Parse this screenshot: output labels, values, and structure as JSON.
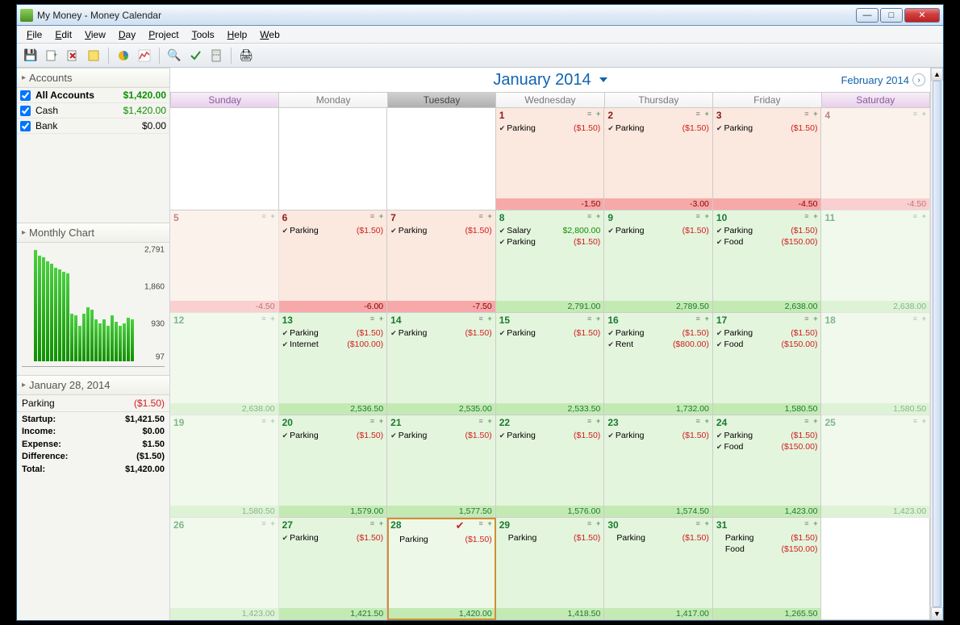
{
  "window": {
    "title": "My Money - Money Calendar"
  },
  "menus": [
    {
      "label": "File",
      "u": "F"
    },
    {
      "label": "Edit",
      "u": "E"
    },
    {
      "label": "View",
      "u": "V"
    },
    {
      "label": "Day",
      "u": "D"
    },
    {
      "label": "Project",
      "u": "P"
    },
    {
      "label": "Tools",
      "u": "T"
    },
    {
      "label": "Help",
      "u": "H"
    },
    {
      "label": "Web",
      "u": "W"
    }
  ],
  "accounts": {
    "header": "Accounts",
    "rows": [
      {
        "name": "All Accounts",
        "amount": "$1,420.00",
        "bold": true,
        "green": true
      },
      {
        "name": "Cash",
        "amount": "$1,420.00",
        "green": true
      },
      {
        "name": "Bank",
        "amount": "$0.00"
      }
    ]
  },
  "monthly_chart": {
    "header": "Monthly Chart"
  },
  "chart_data": {
    "type": "bar",
    "yticks": [
      97,
      930,
      1860,
      2791
    ],
    "values": [
      2791,
      2650,
      2600,
      2500,
      2450,
      2350,
      2300,
      2250,
      2200,
      1200,
      1150,
      900,
      1200,
      1350,
      1300,
      1050,
      950,
      1050,
      900,
      1150,
      1000,
      900,
      950,
      1100,
      1050
    ],
    "ylabel": "",
    "xlabel": ""
  },
  "day_panel": {
    "header": "January 28, 2014",
    "transactions": [
      {
        "name": "Parking",
        "amount": "($1.50)",
        "cls": "red"
      }
    ],
    "summary": [
      {
        "label": "Startup:",
        "value": "$1,421.50"
      },
      {
        "label": "Income:",
        "value": "$0.00"
      },
      {
        "label": "Expense:",
        "value": "$1.50"
      },
      {
        "label": "Difference:",
        "value": "($1.50)"
      },
      {
        "label": "Total:",
        "value": "$1,420.00"
      }
    ]
  },
  "calendar": {
    "title": "January 2014",
    "next": "February 2014",
    "day_headers": [
      "Sunday",
      "Monday",
      "Tuesday",
      "Wednesday",
      "Thursday",
      "Friday",
      "Saturday"
    ],
    "weekend_idx": [
      0,
      6
    ],
    "today_idx": 2,
    "weeks": [
      [
        {
          "empty": true
        },
        {
          "empty": true
        },
        {
          "empty": true
        },
        {
          "num": "1",
          "bg": "pink",
          "items": [
            {
              "chk": true,
              "name": "Parking",
              "amt": "($1.50)",
              "ac": "red"
            }
          ],
          "foot": {
            "txt": "-1.50",
            "cls": "neg"
          }
        },
        {
          "num": "2",
          "bg": "pink",
          "items": [
            {
              "chk": true,
              "name": "Parking",
              "amt": "($1.50)",
              "ac": "red"
            }
          ],
          "foot": {
            "txt": "-3.00",
            "cls": "neg"
          }
        },
        {
          "num": "3",
          "bg": "pink",
          "items": [
            {
              "chk": true,
              "name": "Parking",
              "amt": "($1.50)",
              "ac": "red"
            }
          ],
          "foot": {
            "txt": "-4.50",
            "cls": "neg"
          }
        },
        {
          "num": "4",
          "bg": "pink",
          "dim": true,
          "items": [],
          "foot": {
            "txt": "-4.50",
            "cls": "neg"
          }
        }
      ],
      [
        {
          "num": "5",
          "bg": "pink",
          "dim": true,
          "items": [],
          "foot": {
            "txt": "-4.50",
            "cls": "neg"
          }
        },
        {
          "num": "6",
          "bg": "pink",
          "items": [
            {
              "chk": true,
              "name": "Parking",
              "amt": "($1.50)",
              "ac": "red"
            }
          ],
          "foot": {
            "txt": "-6.00",
            "cls": "neg"
          }
        },
        {
          "num": "7",
          "bg": "pink",
          "items": [
            {
              "chk": true,
              "name": "Parking",
              "amt": "($1.50)",
              "ac": "red"
            }
          ],
          "foot": {
            "txt": "-7.50",
            "cls": "neg"
          }
        },
        {
          "num": "8",
          "bg": "lgreen",
          "items": [
            {
              "chk": true,
              "name": "Salary",
              "amt": "$2,800.00",
              "ac": "green"
            },
            {
              "chk": true,
              "name": "Parking",
              "amt": "($1.50)",
              "ac": "red"
            }
          ],
          "foot": {
            "txt": "2,791.00",
            "cls": "pos"
          }
        },
        {
          "num": "9",
          "bg": "lgreen",
          "items": [
            {
              "chk": true,
              "name": "Parking",
              "amt": "($1.50)",
              "ac": "red"
            }
          ],
          "foot": {
            "txt": "2,789.50",
            "cls": "pos"
          }
        },
        {
          "num": "10",
          "bg": "lgreen",
          "items": [
            {
              "chk": true,
              "name": "Parking",
              "amt": "($1.50)",
              "ac": "red"
            },
            {
              "chk": true,
              "name": "Food",
              "amt": "($150.00)",
              "ac": "red"
            }
          ],
          "foot": {
            "txt": "2,638.00",
            "cls": "pos"
          }
        },
        {
          "num": "11",
          "bg": "lgreen",
          "dim": true,
          "items": [],
          "foot": {
            "txt": "2,638.00",
            "cls": "pos"
          }
        }
      ],
      [
        {
          "num": "12",
          "bg": "lgreen",
          "dim": true,
          "items": [],
          "foot": {
            "txt": "2,638.00",
            "cls": "pos"
          }
        },
        {
          "num": "13",
          "bg": "lgreen",
          "items": [
            {
              "chk": true,
              "name": "Parking",
              "amt": "($1.50)",
              "ac": "red"
            },
            {
              "chk": true,
              "name": "Internet",
              "amt": "($100.00)",
              "ac": "red"
            }
          ],
          "foot": {
            "txt": "2,536.50",
            "cls": "pos"
          }
        },
        {
          "num": "14",
          "bg": "lgreen",
          "items": [
            {
              "chk": true,
              "name": "Parking",
              "amt": "($1.50)",
              "ac": "red"
            }
          ],
          "foot": {
            "txt": "2,535.00",
            "cls": "pos"
          }
        },
        {
          "num": "15",
          "bg": "lgreen",
          "items": [
            {
              "chk": true,
              "name": "Parking",
              "amt": "($1.50)",
              "ac": "red"
            }
          ],
          "foot": {
            "txt": "2,533.50",
            "cls": "pos"
          }
        },
        {
          "num": "16",
          "bg": "lgreen",
          "items": [
            {
              "chk": true,
              "name": "Parking",
              "amt": "($1.50)",
              "ac": "red"
            },
            {
              "chk": true,
              "name": "Rent",
              "amt": "($800.00)",
              "ac": "red"
            }
          ],
          "foot": {
            "txt": "1,732.00",
            "cls": "pos"
          }
        },
        {
          "num": "17",
          "bg": "lgreen",
          "items": [
            {
              "chk": true,
              "name": "Parking",
              "amt": "($1.50)",
              "ac": "red"
            },
            {
              "chk": true,
              "name": "Food",
              "amt": "($150.00)",
              "ac": "red"
            }
          ],
          "foot": {
            "txt": "1,580.50",
            "cls": "pos"
          }
        },
        {
          "num": "18",
          "bg": "lgreen",
          "dim": true,
          "items": [],
          "foot": {
            "txt": "1,580.50",
            "cls": "pos"
          }
        }
      ],
      [
        {
          "num": "19",
          "bg": "lgreen",
          "dim": true,
          "items": [],
          "foot": {
            "txt": "1,580.50",
            "cls": "pos"
          }
        },
        {
          "num": "20",
          "bg": "lgreen",
          "items": [
            {
              "chk": true,
              "name": "Parking",
              "amt": "($1.50)",
              "ac": "red"
            }
          ],
          "foot": {
            "txt": "1,579.00",
            "cls": "pos"
          }
        },
        {
          "num": "21",
          "bg": "lgreen",
          "items": [
            {
              "chk": true,
              "name": "Parking",
              "amt": "($1.50)",
              "ac": "red"
            }
          ],
          "foot": {
            "txt": "1,577.50",
            "cls": "pos"
          }
        },
        {
          "num": "22",
          "bg": "lgreen",
          "items": [
            {
              "chk": true,
              "name": "Parking",
              "amt": "($1.50)",
              "ac": "red"
            }
          ],
          "foot": {
            "txt": "1,576.00",
            "cls": "pos"
          }
        },
        {
          "num": "23",
          "bg": "lgreen",
          "items": [
            {
              "chk": true,
              "name": "Parking",
              "amt": "($1.50)",
              "ac": "red"
            }
          ],
          "foot": {
            "txt": "1,574.50",
            "cls": "pos"
          }
        },
        {
          "num": "24",
          "bg": "lgreen",
          "items": [
            {
              "chk": true,
              "name": "Parking",
              "amt": "($1.50)",
              "ac": "red"
            },
            {
              "chk": true,
              "name": "Food",
              "amt": "($150.00)",
              "ac": "red"
            }
          ],
          "foot": {
            "txt": "1,423.00",
            "cls": "pos"
          }
        },
        {
          "num": "25",
          "bg": "lgreen",
          "dim": true,
          "items": [],
          "foot": {
            "txt": "1,423.00",
            "cls": "pos"
          }
        }
      ],
      [
        {
          "num": "26",
          "bg": "lgreen",
          "dim": true,
          "items": [],
          "foot": {
            "txt": "1,423.00",
            "cls": "pos"
          }
        },
        {
          "num": "27",
          "bg": "lgreen",
          "items": [
            {
              "chk": true,
              "name": "Parking",
              "amt": "($1.50)",
              "ac": "red"
            }
          ],
          "foot": {
            "txt": "1,421.50",
            "cls": "pos"
          }
        },
        {
          "num": "28",
          "bg": "lgreen",
          "selected": true,
          "items": [
            {
              "chk": false,
              "redchk": true,
              "name": "Parking",
              "amt": "($1.50)",
              "ac": "red"
            }
          ],
          "foot": {
            "txt": "1,420.00",
            "cls": "pos"
          }
        },
        {
          "num": "29",
          "bg": "lgreen",
          "items": [
            {
              "chk": false,
              "name": "Parking",
              "amt": "($1.50)",
              "ac": "red"
            }
          ],
          "foot": {
            "txt": "1,418.50",
            "cls": "pos"
          }
        },
        {
          "num": "30",
          "bg": "lgreen",
          "items": [
            {
              "chk": false,
              "name": "Parking",
              "amt": "($1.50)",
              "ac": "red"
            }
          ],
          "foot": {
            "txt": "1,417.00",
            "cls": "pos"
          }
        },
        {
          "num": "31",
          "bg": "lgreen",
          "items": [
            {
              "chk": false,
              "name": "Parking",
              "amt": "($1.50)",
              "ac": "red"
            },
            {
              "chk": false,
              "name": "Food",
              "amt": "($150.00)",
              "ac": "red"
            }
          ],
          "foot": {
            "txt": "1,265.50",
            "cls": "pos"
          }
        },
        {
          "empty": true
        }
      ]
    ]
  }
}
